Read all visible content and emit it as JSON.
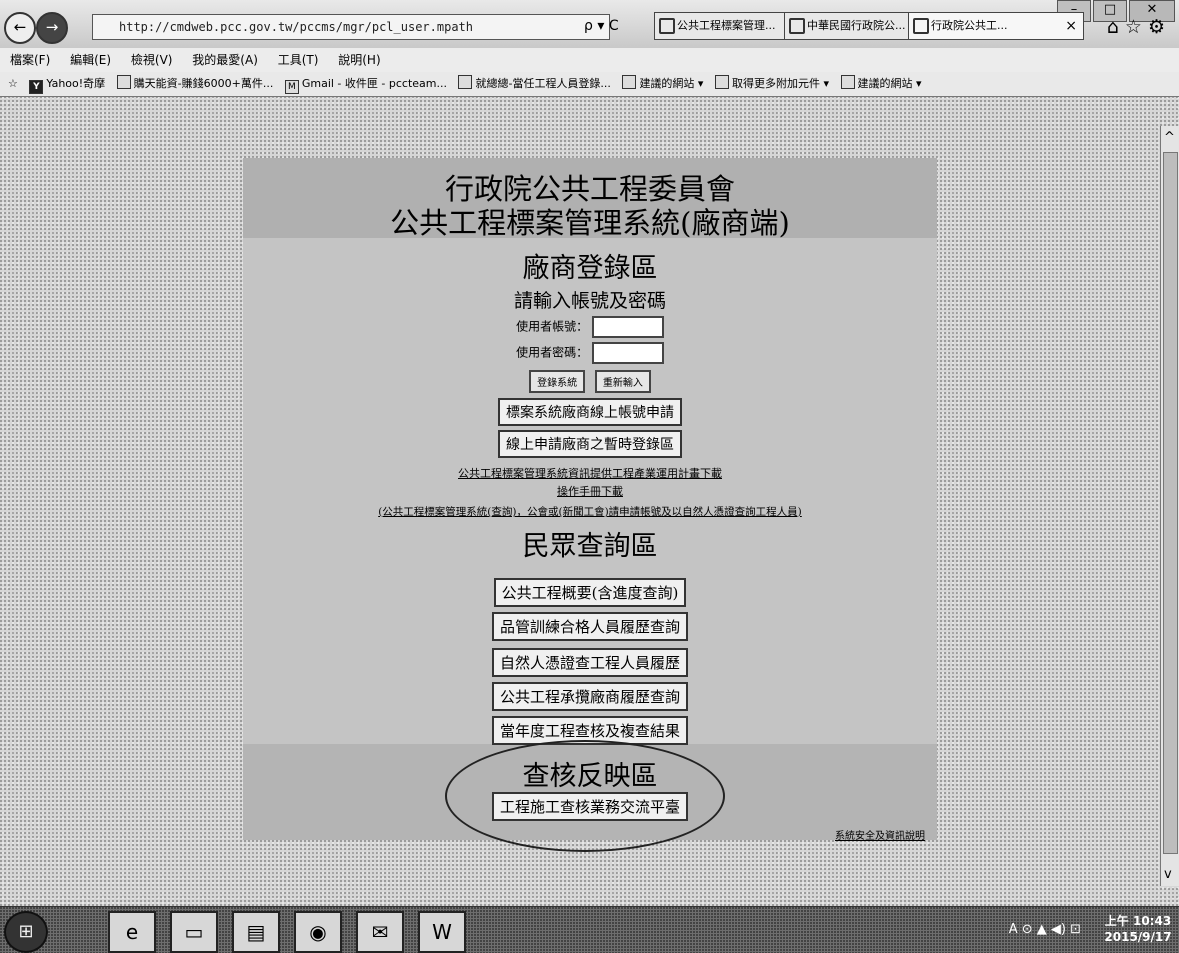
{
  "browser": {
    "url": "http://cmdweb.pcc.gov.tw/pccms/mgr/pcl_user.mpath",
    "address_tools": "ρ ▾ C",
    "tabs": [
      {
        "label": "公共工程標案管理..."
      },
      {
        "label": "中華民國行政院公..."
      },
      {
        "label": "行政院公共工..."
      }
    ],
    "right_icons": "⌂☆⚙",
    "menu": [
      "檔案(F)",
      "編輯(E)",
      "檢視(V)",
      "我的最愛(A)",
      "工具(T)",
      "說明(H)"
    ],
    "favorites": [
      {
        "icon": "Y",
        "label": "Yahoo!奇摩"
      },
      {
        "icon": "",
        "label": "購天能資-賺錢6000+萬件..."
      },
      {
        "icon": "M",
        "label": "Gmail - 收件匣 - pccteam..."
      },
      {
        "icon": "",
        "label": "就總總-當任工程人員登錄..."
      },
      {
        "icon": "",
        "label": "建議的網站 ▾"
      },
      {
        "icon": "",
        "label": "取得更多附加元件 ▾"
      },
      {
        "icon": "",
        "label": "建議的網站 ▾"
      }
    ]
  },
  "page": {
    "header": {
      "line1": "行政院公共工程委員會",
      "line2": "公共工程標案管理系統(廠商端)"
    },
    "login": {
      "heading": "廠商登錄區",
      "prompt": "請輸入帳號及密碼",
      "user_label": "使用者帳號：",
      "pass_label": "使用者密碼：",
      "login_btn": "登錄系統",
      "reset_btn": "重新輸入",
      "online_apply_btn": "標案系統廠商線上帳號申請",
      "temp_login_btn": "線上申請廠商之暫時登錄區",
      "link_download": "公共工程標案管理系統資訊提供工程產業運用計畫下載",
      "link_manual": "操作手冊下載",
      "link_note": "(公共工程標案管理系統(查詢)，公會或(新聞工會)請申請帳號及以自然人憑證查詢工程人員)"
    },
    "public": {
      "heading": "民眾查詢區",
      "buttons": [
        "公共工程概要(含進度查詢)",
        "品管訓練合格人員履歷查詢",
        "自然人憑證查工程人員履歷",
        "公共工程承攬廠商履歷查詢",
        "當年度工程查核及複查結果"
      ]
    },
    "audit": {
      "heading": "查核反映區",
      "button": "工程施工查核業務交流平臺",
      "footer_link": "系統安全及資訊說明"
    }
  },
  "taskbar": {
    "tray_text": "A ⊙ ▲ ◀) ⊡",
    "time": "上午 10:43",
    "date": "2015/9/17"
  }
}
